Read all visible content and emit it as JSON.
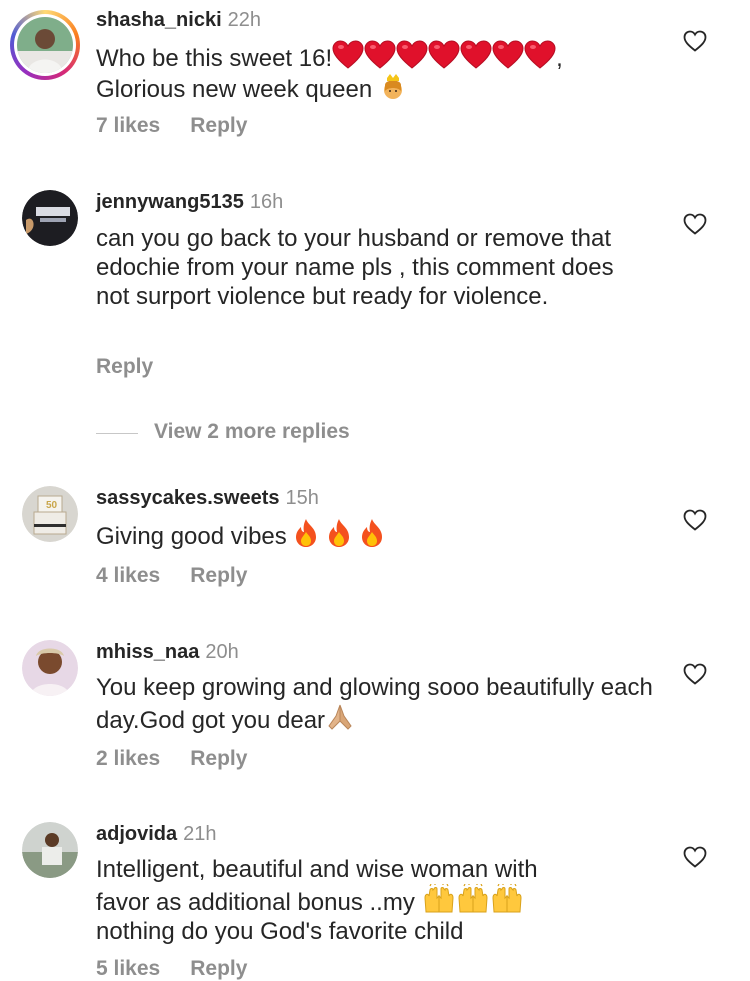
{
  "comments": [
    {
      "username": "shasha_nicki",
      "time": "22h",
      "text_line1": "Who be this sweet 16!",
      "text_line1_tail": ",",
      "text_line2": "Glorious new week queen",
      "likes": "7 likes",
      "reply": "Reply",
      "has_story": true
    },
    {
      "username": "jennywang5135",
      "time": "16h",
      "text": "can you go back to your husband or remove that edochie from your name pls , this comment does not surport violence but ready for violence.",
      "reply": "Reply",
      "view_more": "View 2 more replies"
    },
    {
      "username": "sassycakes.sweets",
      "time": "15h",
      "text": "Giving good vibes",
      "likes": "4 likes",
      "reply": "Reply"
    },
    {
      "username": "mhiss_naa",
      "time": "20h",
      "text": "You keep growing and glowing sooo beautifully each day.God got you dear",
      "likes": "2 likes",
      "reply": "Reply"
    },
    {
      "username": "adjovida",
      "time": "21h",
      "text_line1": "Intelligent, beautiful and wise woman with",
      "text_line2": "favor as additional bonus ..my",
      "text_line3": "nothing do you God's favorite child",
      "likes": "5 likes",
      "reply": "Reply"
    }
  ],
  "icons": {
    "like": "heart-outline-icon",
    "emoji_heart": "red-heart-emoji",
    "emoji_crown": "princess-emoji",
    "emoji_fire": "fire-emoji",
    "emoji_pray": "folded-hands-emoji",
    "emoji_raise": "raising-hands-emoji"
  },
  "colors": {
    "text": "#262626",
    "secondary": "#8e8e8e",
    "heart_emoji": "#e0112b",
    "fire": "#f4511e"
  }
}
